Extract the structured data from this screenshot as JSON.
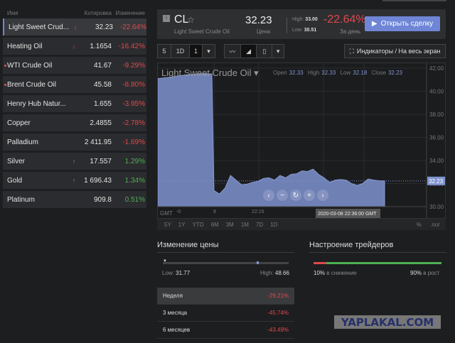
{
  "list": {
    "headers": {
      "name": "Имя",
      "quote": "Котировка",
      "change": "Изменение"
    },
    "items": [
      {
        "name": "Light Sweet Crud...",
        "arrow": "↓",
        "quote": "32.23",
        "change": "-22.64%",
        "dir": "down",
        "selected": true
      },
      {
        "name": "Heating Oil",
        "arrow": "↓",
        "quote": "1.1654",
        "change": "-16.42%",
        "dir": "down"
      },
      {
        "name": "WTI Crude Oil",
        "arrow": "",
        "quote": "41.67",
        "change": "-9.29%",
        "dir": "down",
        "dot": true
      },
      {
        "name": "Brent Crude Oil",
        "arrow": "",
        "quote": "45.58",
        "change": "-8.80%",
        "dir": "down",
        "dot": true
      },
      {
        "name": "Henry Hub Natur...",
        "arrow": "",
        "quote": "1.655",
        "change": "-3.95%",
        "dir": "down"
      },
      {
        "name": "Copper",
        "arrow": "",
        "quote": "2.4855",
        "change": "-2.78%",
        "dir": "down"
      },
      {
        "name": "Palladium",
        "arrow": "",
        "quote": "2 411.95",
        "change": "-1.69%",
        "dir": "down"
      },
      {
        "name": "Silver",
        "arrow": "↑",
        "quote": "17.557",
        "change": "1.29%",
        "dir": "up"
      },
      {
        "name": "Gold",
        "arrow": "↑",
        "quote": "1 696.43",
        "change": "1.34%",
        "dir": "up"
      },
      {
        "name": "Platinum",
        "arrow": "",
        "quote": "909.8",
        "change": "0.51%",
        "dir": "up"
      }
    ]
  },
  "header": {
    "symbol": "CL",
    "star": "☆",
    "name": "Light Sweet Crude Oil",
    "price": "32.23",
    "price_label": "Цена",
    "high_label": "High:",
    "high": "33.00",
    "low_label": "Low:",
    "low": "30.51",
    "change": "-22.64%",
    "change_label": "За день",
    "trade_button": "Открыть сделку"
  },
  "toolbar": {
    "interval": [
      "5",
      "1D",
      "1"
    ],
    "indicators": "Индикаторы / На весь экран"
  },
  "chart": {
    "title": "Light Sweet Crude Oil",
    "ohlc": {
      "open_label": "Open",
      "open": "32.33",
      "high_label": "High",
      "high": "32.33",
      "low_label": "Low",
      "low": "32.18",
      "close_label": "Close",
      "close": "32.23"
    },
    "gmt": "GMT",
    "x_ticks": [
      "-0",
      "8",
      "22:15"
    ],
    "crosshair_label": "2020-03-08 22:36:00 GMT",
    "current_label": "32.23",
    "ranges": [
      "5Y",
      "1Y",
      "YTD",
      "6M",
      "3M",
      "1M",
      "7D",
      "1D"
    ],
    "pct": "%",
    "log": "лог",
    "area_color": "#6f80b5"
  },
  "chart_data": {
    "type": "area",
    "ylim": [
      30,
      42
    ],
    "y_ticks": [
      "42.00",
      "40.00",
      "38.00",
      "36.00",
      "34.00",
      "32.00",
      "30.00"
    ],
    "values": [
      41.1,
      41.2,
      41.35,
      41.45,
      41.5,
      41.5,
      31.4,
      31.1,
      31.6,
      32.7,
      32.3,
      31.9,
      31.95,
      32.1,
      32.2,
      32.45,
      32.5,
      32.3,
      32.7,
      32.5,
      32.8,
      32.85,
      33.1,
      33.05,
      33.25,
      32.8,
      32.5,
      32.1,
      32.3,
      32.35,
      32.3,
      32.0,
      31.85,
      32.0,
      32.4,
      32.3,
      32.25,
      32.23
    ],
    "last": 32.23
  },
  "price_change": {
    "title": "Изменение цены",
    "low_label": "Low:",
    "low": "31.77",
    "high_label": "High:",
    "high": "48.66",
    "rows": [
      {
        "period": "Неделя",
        "value": "-29.21%"
      },
      {
        "period": "3 месяца",
        "value": "-45.74%"
      },
      {
        "period": "6 месяцев",
        "value": "-43.49%"
      }
    ]
  },
  "sentiment": {
    "title": "Настроение трейдеров",
    "down_pct": "10%",
    "down_label": "в снижение",
    "up_pct": "90%",
    "up_label": "в рост",
    "down_fraction": 0.1,
    "colors": {
      "down": "#e0484d",
      "up": "#4cb050"
    }
  },
  "watermark": "YAPLAKAL.COM"
}
